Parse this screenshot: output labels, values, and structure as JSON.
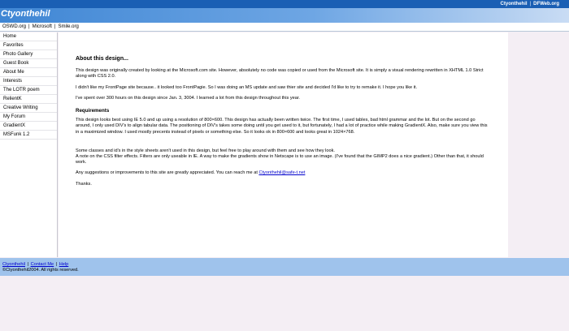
{
  "top_links": [
    "Ctyonthehil",
    "DFWeb.org"
  ],
  "site_title": "Ctyonthehil",
  "sub_links": [
    "OSWD.org",
    "Microsoft",
    "Smile.org"
  ],
  "sidebar": {
    "items": [
      "Home",
      "Favorites",
      "Photo Gallery",
      "Guest Book",
      "About Me",
      "Interests",
      "The LOTR poem",
      "RelientK",
      "Creative Writing",
      "My Forum",
      "GradientX",
      "MSFunk 1.2"
    ]
  },
  "content": {
    "heading": "About this design...",
    "p1": "This design was originally created by looking at the Microsoft.com site. However, absolutely no code was copied or used from the Microsoft site. It is simply a visual rendering rewritten in XHTML 1.0 Strict along with CSS 2.0.",
    "p2": "I didn't like my FrontPage site because.. it looked too FrontPagie. So I was doing an MS update and saw thier site and decided I'd like to try to remake it. I hope you like it.",
    "p3": "I've spent over 300 hours on this design since Jan. 3, 3004. I learned a lot from this design throughout this year.",
    "requirements_heading": "Requirements",
    "p4": "This design looks best using IE 5.0 and up using a resolution of 800×600. This design has actually been written twice. The first time, I used tables, bad html grammar and the lot. But on the second go around, I only used DIV's to align tabular data. The positioning of DIV's takes some doing until you get used to it, but fortunately, I had a lot of practice while making GradientX. Also, make sure you view this in a maximized window. I used mostly precents instead of pixels or something else. So it looks ok in 800×600 and looks great in 1024×768.",
    "p5a": "Some classes and id's in the style sheets aren't used in this design, but feel free to play around with them and see how they look.",
    "p5b": "A note on the CSS filter effects. Filters are only useable in IE. A way to make the gradients show in Netscape is to use an image. (I've found that the GIMP2 does a nice gradient.) Other than that, it should work.",
    "p6_prefix": "Any suggestions or improvements to this site are greatly appreciated. You can reach me at ",
    "p6_email": "Ctyonthehil@safe-t.net",
    "thanks": "Thanks."
  },
  "footer": {
    "links": [
      "Ctyonthehil",
      "Contact Me",
      "Help"
    ],
    "copyright": "©Ctyonthehil2004. All rights reserved."
  },
  "colors": {
    "top_bar": "#1a5fb4",
    "header_gradient_start": "#3f86d4",
    "footer": "#9fc3ec",
    "link": "#0000cc",
    "background": "#f4eef4"
  }
}
